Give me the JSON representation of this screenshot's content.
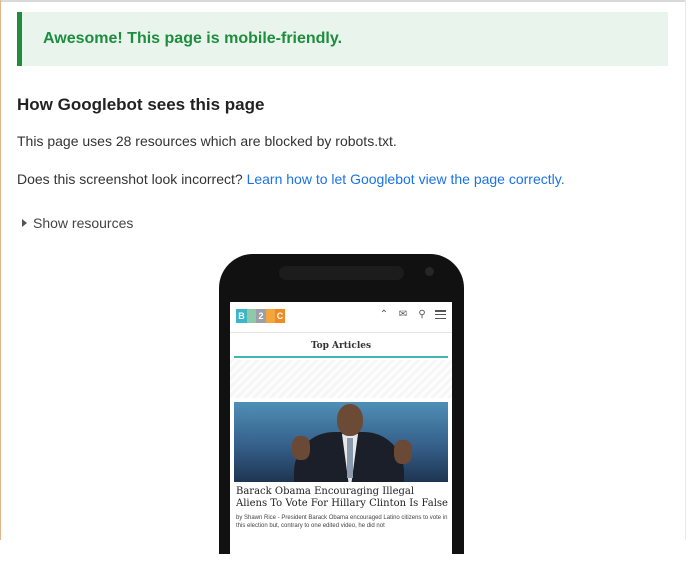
{
  "banner": {
    "text": "Awesome! This page is mobile-friendly."
  },
  "section": {
    "heading": "How Googlebot sees this page",
    "blocked_text": "This page uses 28 resources which are blocked by robots.txt.",
    "question_text": "Does this screenshot look incorrect?",
    "learn_link": "Learn how to let Googlebot view the page correctly.",
    "show_resources": "Show resources"
  },
  "preview": {
    "logo_letters": [
      "B",
      "",
      "2",
      "",
      "C"
    ],
    "icons": [
      "chevron-up-icon",
      "mail-icon",
      "search-icon",
      "menu-icon"
    ],
    "top_articles": "Top Articles",
    "article_title": "Barack Obama Encouraging Illegal Aliens To Vote For Hillary Clinton Is False",
    "article_meta": "by Shawn Rice - President Barack Obama encouraged Latino citizens to vote in this election but, contrary to one edited video, he did not"
  },
  "colors": {
    "success": "#1e8e3e",
    "success_bg": "#e8f4ec",
    "link": "#1a73e8",
    "accent": "#3fb8b0"
  }
}
